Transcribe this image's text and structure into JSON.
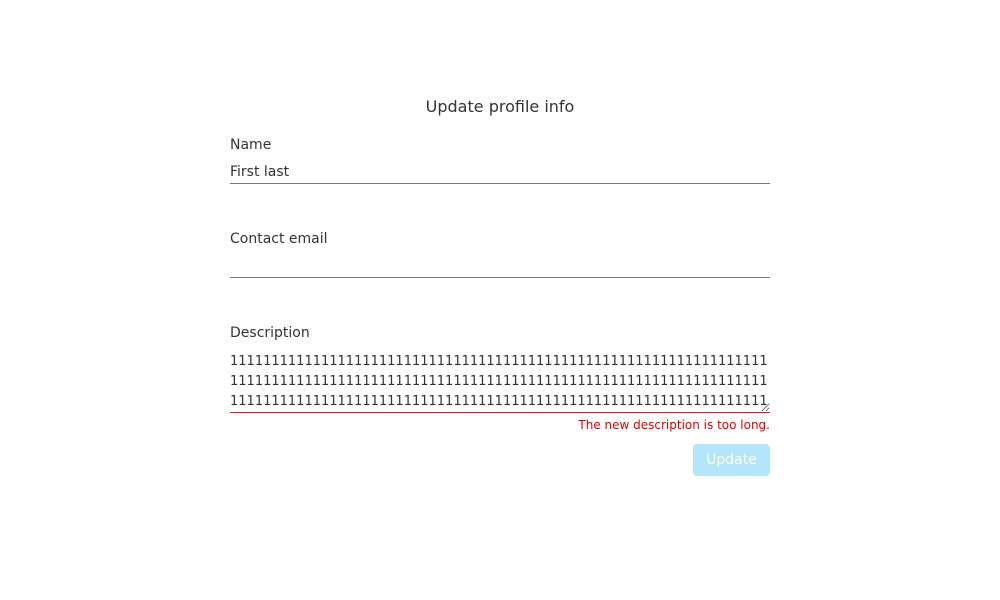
{
  "form": {
    "title": "Update profile info",
    "name": {
      "label": "Name",
      "value": "First last"
    },
    "email": {
      "label": "Contact email",
      "value": ""
    },
    "description": {
      "label": "Description",
      "value": "11111111111111111111111111111111111111111111111111111111111111111111111111111111111111111111111111111111111111111111111111111111111111111111111111111111111111111111111111111111111111111111111111111111111111111111",
      "error": "The new description is too long.",
      "error_color": "#e00000"
    },
    "submit": {
      "label": "Update",
      "disabled_color": "#b3e5fc"
    }
  }
}
